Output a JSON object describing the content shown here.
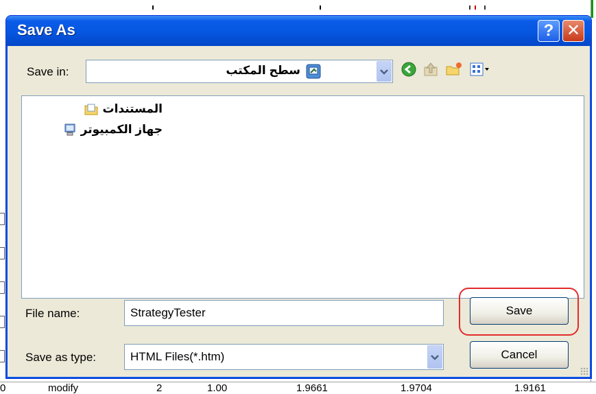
{
  "dialog": {
    "title": "Save As",
    "help_glyph": "?",
    "close_glyph": "✕"
  },
  "save_in": {
    "label": "Save in:",
    "value": "سطح المكتب",
    "icon": "desktop-icon"
  },
  "toolbar": {
    "back_icon": "back-arrow-icon",
    "up_icon": "up-folder-icon",
    "new_folder_icon": "new-folder-icon",
    "views_icon": "views-menu-icon"
  },
  "files": [
    {
      "name": "المستندات",
      "icon": "documents-folder-icon"
    },
    {
      "name": "جهاز الكمبيوتر",
      "icon": "computer-icon"
    }
  ],
  "file_name": {
    "label": "File name:",
    "value": "StrategyTester"
  },
  "save_as_type": {
    "label": "Save as type:",
    "value": "HTML Files(*.htm)"
  },
  "buttons": {
    "save": "Save",
    "cancel": "Cancel"
  },
  "background": {
    "bottom_row": [
      "modify",
      "2",
      "1.00",
      "1.9661",
      "1.9704",
      "1.9161"
    ]
  },
  "colors": {
    "titlebar": "#0656e0",
    "dialog_bg": "#ece9d8",
    "highlight": "#e32b2b"
  }
}
